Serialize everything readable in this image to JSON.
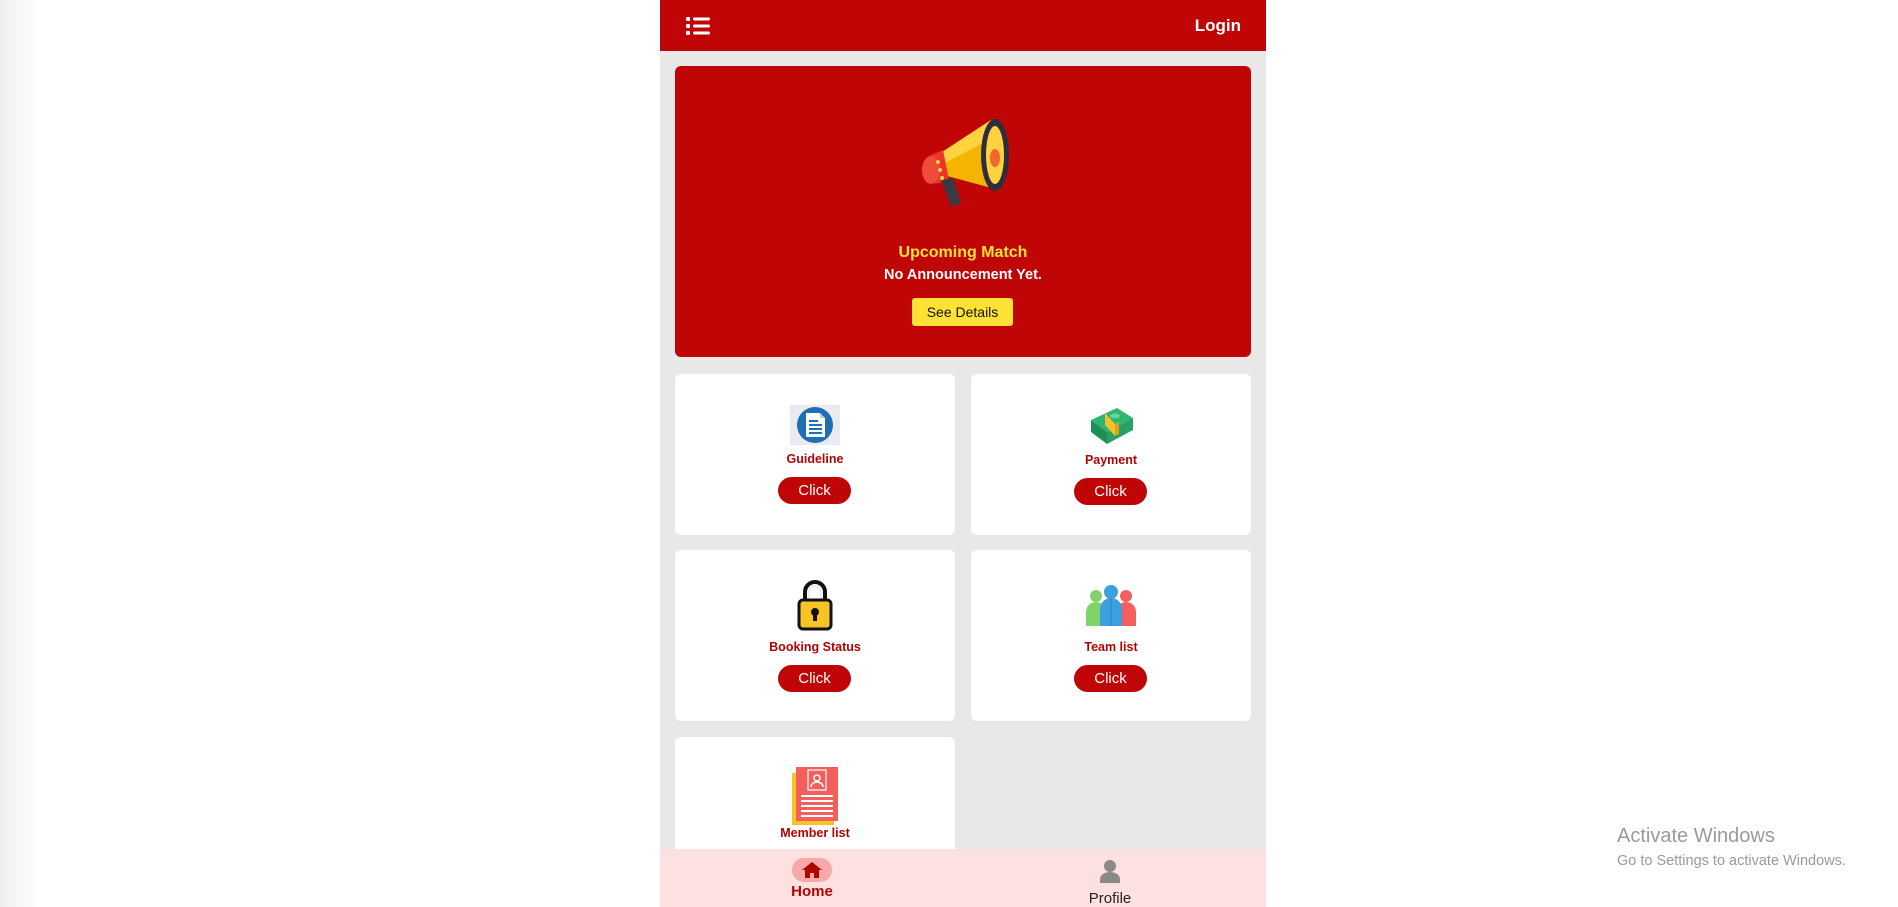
{
  "header": {
    "menu_icon": "list-menu-icon",
    "login_label": "Login"
  },
  "banner": {
    "icon": "megaphone-icon",
    "title": "Upcoming Match",
    "subtitle": "No Announcement Yet.",
    "button_label": "See Details"
  },
  "cards": [
    {
      "label": "Guideline",
      "icon": "document-icon",
      "button_label": "Click"
    },
    {
      "label": "Payment",
      "icon": "money-icon",
      "button_label": "Click"
    },
    {
      "label": "Booking Status",
      "icon": "padlock-icon",
      "button_label": "Click"
    },
    {
      "label": "Team list",
      "icon": "team-icon",
      "button_label": "Click"
    },
    {
      "label": "Member list",
      "icon": "member-list-icon"
    }
  ],
  "bottom_nav": {
    "items": [
      {
        "label": "Home",
        "icon": "home-icon",
        "active": true
      },
      {
        "label": "Profile",
        "icon": "person-icon",
        "active": false
      }
    ]
  },
  "windows_watermark": {
    "title": "Activate Windows",
    "subtitle": "Go to Settings to activate Windows."
  },
  "colors": {
    "primary_red": "#bf0505",
    "accent_yellow": "#ffe234",
    "background": "#e8e8e8",
    "nav_background": "#fde0e0"
  }
}
